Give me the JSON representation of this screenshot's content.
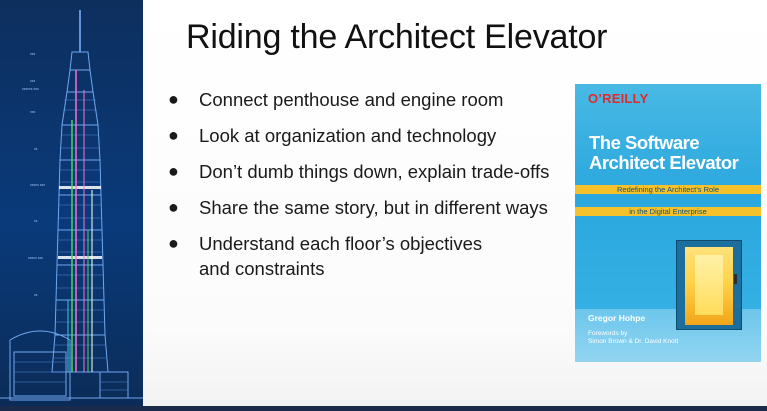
{
  "slide": {
    "title": "Riding the Architect Elevator",
    "bullets": [
      {
        "marker": "●",
        "lines": [
          "Connect penthouse and engine room"
        ]
      },
      {
        "marker": "●",
        "lines": [
          "Look at organization and technology"
        ]
      },
      {
        "marker": "●",
        "lines": [
          "Don’t dumb things down, explain trade-offs"
        ]
      },
      {
        "marker": "●",
        "lines": [
          "Share the same story, but in different ways"
        ]
      },
      {
        "marker": "●",
        "lines": [
          "Understand each floor’s objectives",
          "and constraints"
        ]
      }
    ]
  },
  "book": {
    "publisher": "O’REILLY",
    "title_line1": "The Software",
    "title_line2": "Architect Elevator",
    "subtitle_line1": "Redefining the Architect’s Role",
    "subtitle_line2": "in the Digital Enterprise",
    "author": "Gregor Hohpe",
    "forewords_label": "Forewords by",
    "forewords_names": "Simon Brown & Dr. David Knott"
  },
  "colors": {
    "tower_background": "#0b3a78",
    "book_background": "#2aa7de",
    "book_band": "#f5c22b",
    "publisher_red": "#e1292b"
  },
  "icons": {
    "tower_image": "taipei-101-blueprint-icon"
  }
}
